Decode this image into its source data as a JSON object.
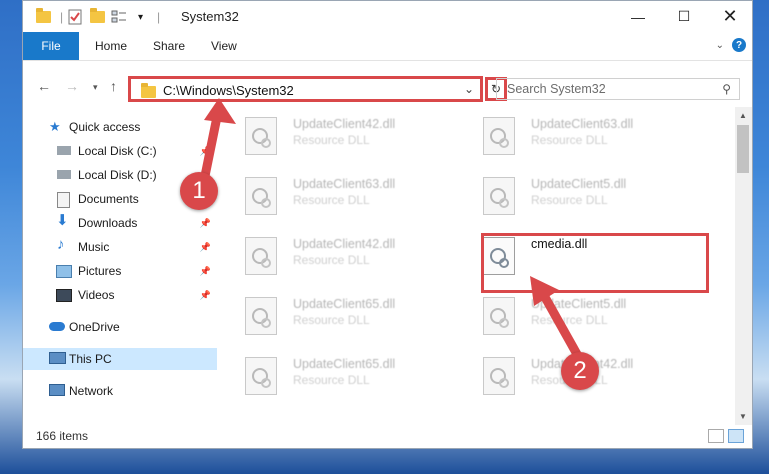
{
  "window": {
    "title": "System32",
    "controls": [
      "minimize",
      "maximize",
      "close"
    ]
  },
  "ribbon": {
    "file_tab": "File",
    "tabs": [
      "Home",
      "Share",
      "View"
    ],
    "help": "?"
  },
  "address": {
    "path": "C:\\Windows\\System32",
    "search_placeholder": "Search System32"
  },
  "sidebar": {
    "items": [
      {
        "label": "Quick access",
        "icon": "star-icon"
      },
      {
        "label": "Local Disk (C:)",
        "icon": "drive-icon"
      },
      {
        "label": "Local Disk (D:)",
        "icon": "drive-icon"
      },
      {
        "label": "Documents",
        "icon": "documents-icon"
      },
      {
        "label": "Downloads",
        "icon": "download-icon"
      },
      {
        "label": "Music",
        "icon": "music-icon"
      },
      {
        "label": "Pictures",
        "icon": "pictures-icon"
      },
      {
        "label": "Videos",
        "icon": "videos-icon"
      },
      {
        "label": "OneDrive",
        "icon": "cloud-icon"
      },
      {
        "label": "This PC",
        "icon": "computer-icon"
      },
      {
        "label": "Network",
        "icon": "network-icon"
      }
    ]
  },
  "files": [
    {
      "name": "UpdateClient42.dll",
      "type": "Resource DLL"
    },
    {
      "name": "UpdateClient63.dll",
      "type": "Resource DLL"
    },
    {
      "name": "UpdateClient63.dll",
      "type": "Resource DLL"
    },
    {
      "name": "UpdateClient5.dll",
      "type": "Resource DLL"
    },
    {
      "name": "UpdateClient42.dll",
      "type": "Resource DLL"
    },
    {
      "name": "cmedia.dll",
      "type": ""
    },
    {
      "name": "UpdateClient65.dll",
      "type": "Resource DLL"
    },
    {
      "name": "UpdateClient5.dll",
      "type": "Resource DLL"
    },
    {
      "name": "UpdateClient65.dll",
      "type": "Resource DLL"
    },
    {
      "name": "UpdateClient42.dll",
      "type": "Resource DLL"
    }
  ],
  "status": {
    "item_count": "166 items"
  },
  "annotations": {
    "badge1": "1",
    "badge2": "2",
    "color": "#d9484a"
  },
  "colors": {
    "accent": "#1979ca",
    "selection": "#cce8ff",
    "highlight": "#d9484a"
  }
}
